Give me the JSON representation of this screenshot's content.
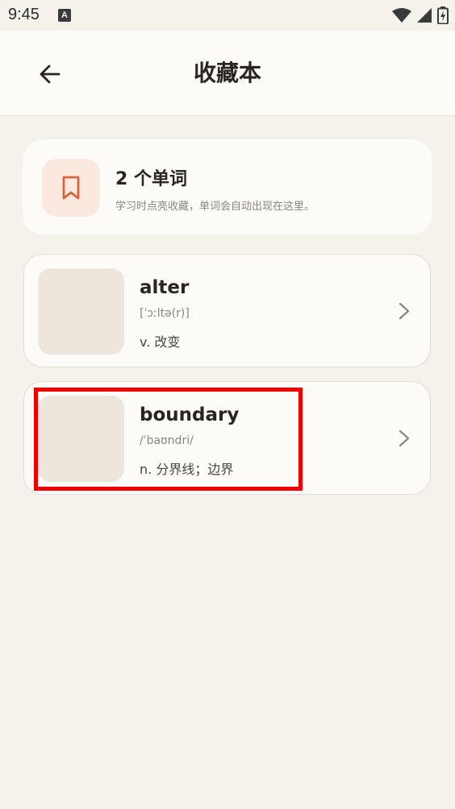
{
  "status_bar": {
    "time": "9:45",
    "notification_glyph": "A",
    "icons": [
      "wifi-icon",
      "signal-icon",
      "battery-icon"
    ]
  },
  "header": {
    "title": "收藏本",
    "back_icon": "back-arrow-icon"
  },
  "summary": {
    "icon": "bookmark-icon",
    "count_text": "2 个单词",
    "hint": "学习时点亮收藏，单词会自动出现在这里。"
  },
  "words": [
    {
      "word": "alter",
      "phonetic": "[ˈɔːltə(r)]",
      "definition": "v. 改变"
    },
    {
      "word": "boundary",
      "phonetic": "/ˈbaʊndri/",
      "definition": "n. 分界线；边界"
    }
  ],
  "colors": {
    "background": "#F5F2EC",
    "card": "#FDFBF7",
    "accent": "#D9643B",
    "accent_bg": "#FBE8DE",
    "highlight": "#F20000"
  }
}
